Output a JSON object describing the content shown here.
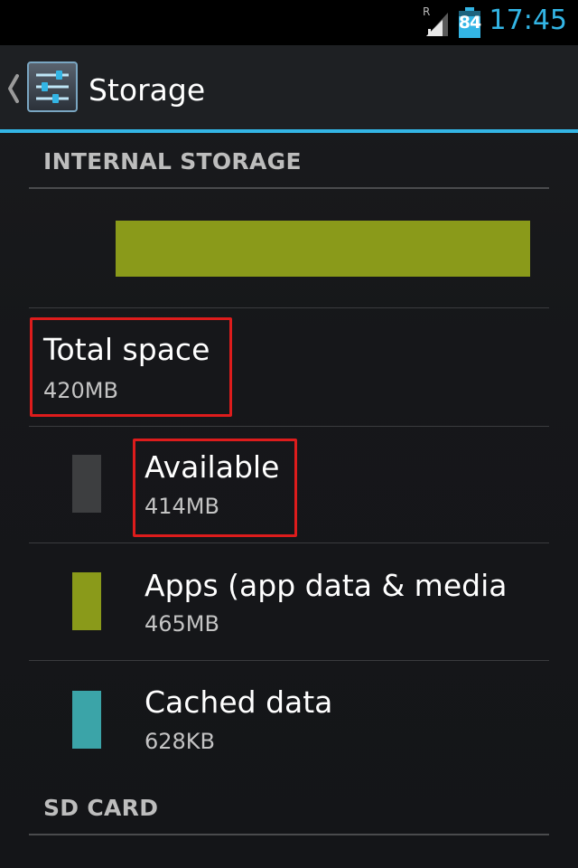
{
  "status_bar": {
    "roaming_indicator": "R",
    "battery_level": "84",
    "time": "17:45",
    "icons": [
      "signal-icon",
      "battery-icon"
    ]
  },
  "action_bar": {
    "title": "Storage",
    "icons": [
      "back-chevron-icon",
      "settings-sliders-icon"
    ]
  },
  "internal_storage": {
    "header": "INTERNAL STORAGE",
    "usage_fraction_used": 1.0,
    "total": {
      "label": "Total space",
      "value": "420MB"
    },
    "items": [
      {
        "label": "Available",
        "value": "414MB",
        "color": "#3d3e40"
      },
      {
        "label": "Apps (app data & media content)",
        "value": "465MB",
        "color": "#8a9a1a"
      },
      {
        "label": "Cached data",
        "value": "628KB",
        "color": "#3ba4a8"
      }
    ]
  },
  "sd_card": {
    "header": "SD CARD"
  },
  "colors": {
    "accent": "#33b5e5",
    "highlight": "#dd1c1c",
    "apps": "#8a9a1a",
    "cached": "#3ba4a8"
  }
}
